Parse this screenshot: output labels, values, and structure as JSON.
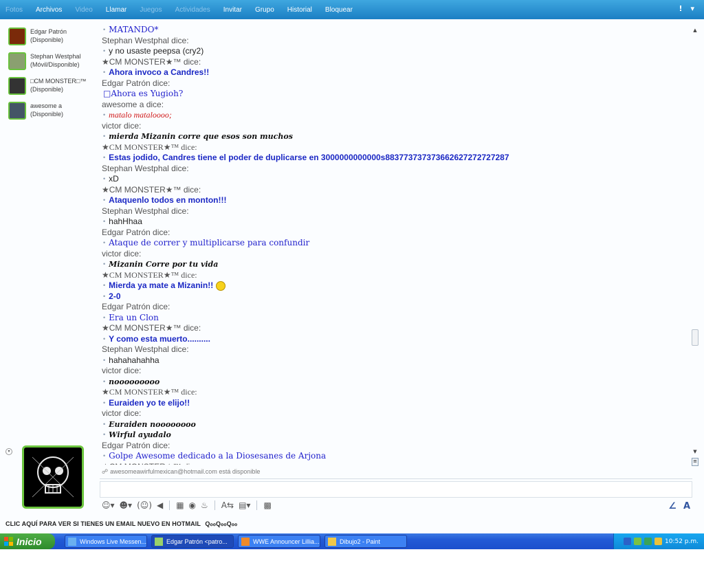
{
  "menu": [
    {
      "label": "Fotos",
      "disabled": true
    },
    {
      "label": "Archivos",
      "disabled": false
    },
    {
      "label": "Video",
      "disabled": true
    },
    {
      "label": "Llamar",
      "disabled": false
    },
    {
      "label": "Juegos",
      "disabled": true
    },
    {
      "label": "Actividades",
      "disabled": true
    },
    {
      "label": "Invitar",
      "disabled": false
    },
    {
      "label": "Grupo",
      "disabled": false
    },
    {
      "label": "Historial",
      "disabled": false
    },
    {
      "label": "Bloquear",
      "disabled": false
    }
  ],
  "topbar_right": {
    "alert": "!",
    "options": "▾"
  },
  "contacts": [
    {
      "name": "Edgar Patrón",
      "status": "(Disponible)",
      "avatar": "fire-avatar"
    },
    {
      "name": "Stephan Westphal",
      "status": "(Móvil/Disponible)",
      "avatar": "person-avatar"
    },
    {
      "name": "□CM MONSTER□™",
      "status": "(Disponible)",
      "avatar": "wrestler-avatar"
    },
    {
      "name": "awesome a",
      "status": "(Disponible)",
      "avatar": "ring-avatar"
    }
  ],
  "conversation": [
    {
      "type": "msg",
      "text": "MATANDO*",
      "style": "c-serif"
    },
    {
      "type": "speaker",
      "text": "Stephan Westphal dice:"
    },
    {
      "type": "msg",
      "text": "y no usaste peepsa (cry2)",
      "style": "c-black"
    },
    {
      "type": "speaker",
      "text": "★CM MONSTER★™ dice:"
    },
    {
      "type": "msg",
      "text": "Ahora invoco a Candres!!",
      "style": "c-bold-blue"
    },
    {
      "type": "speaker",
      "text": "Edgar Patrón dice:"
    },
    {
      "type": "msg",
      "text": "□Ahora es Yugioh?",
      "style": "c-serif",
      "nodot": true
    },
    {
      "type": "speaker",
      "text": "awesome a dice:"
    },
    {
      "type": "msg",
      "text": "matalo mataloooo;",
      "style": "c-red"
    },
    {
      "type": "speaker",
      "text": "victor dice:"
    },
    {
      "type": "msg",
      "text": "mierda Mizanin corre que esos son muchos",
      "style": "c-serif-bold"
    },
    {
      "type": "speaker",
      "text": "★CM MONSTER★™ dice:",
      "serif": true
    },
    {
      "type": "msg",
      "text": "Estas jodido, Candres tiene el poder de duplicarse en 3000000000000s883773737373662627272727287",
      "style": "c-bold-blue"
    },
    {
      "type": "speaker",
      "text": "Stephan Westphal dice:"
    },
    {
      "type": "msg",
      "text": "xD",
      "style": "c-black"
    },
    {
      "type": "speaker",
      "text": "★CM MONSTER★™ dice:"
    },
    {
      "type": "msg",
      "text": "Ataquenlo todos en monton!!!",
      "style": "c-bold-blue"
    },
    {
      "type": "speaker",
      "text": "Stephan Westphal dice:"
    },
    {
      "type": "msg",
      "text": "hahHhaa",
      "style": "c-black"
    },
    {
      "type": "speaker",
      "text": "Edgar Patrón dice:"
    },
    {
      "type": "msg",
      "text": "Ataque de correr y multiplicarse para confundir",
      "style": "c-serif"
    },
    {
      "type": "speaker",
      "text": "victor dice:"
    },
    {
      "type": "msg",
      "text": "Mizanin Corre por tu vida",
      "style": "c-serif-bold"
    },
    {
      "type": "speaker",
      "text": "★CM MONSTER★™ dice:",
      "serif": true
    },
    {
      "type": "msg",
      "text": "Mierda ya mate a Mizanin!!",
      "style": "c-bold-blue",
      "emoticon": true
    },
    {
      "type": "msg",
      "text": "2-0",
      "style": "c-bold-blue"
    },
    {
      "type": "speaker",
      "text": "Edgar Patrón dice:"
    },
    {
      "type": "msg",
      "text": "Era un Clon",
      "style": "c-serif"
    },
    {
      "type": "speaker",
      "text": "★CM MONSTER★™ dice:"
    },
    {
      "type": "msg",
      "text": "Y como esta muerto..........",
      "style": "c-bold-blue"
    },
    {
      "type": "speaker",
      "text": "Stephan Westphal dice:"
    },
    {
      "type": "msg",
      "text": "hahahahahha",
      "style": "c-black"
    },
    {
      "type": "speaker",
      "text": "victor dice:"
    },
    {
      "type": "msg",
      "text": "nooooooooo",
      "style": "c-serif-bold"
    },
    {
      "type": "speaker",
      "text": "★CM MONSTER★™ dice:",
      "serif": true
    },
    {
      "type": "msg",
      "text": "Euraiden yo te elijo!!",
      "style": "c-bold-blue"
    },
    {
      "type": "speaker",
      "text": "victor dice:"
    },
    {
      "type": "msg",
      "text": "Euraiden noooooooo",
      "style": "c-serif-bold"
    },
    {
      "type": "msg",
      "text": "Wirful ayudalo",
      "style": "c-serif-bold"
    },
    {
      "type": "speaker",
      "text": "Edgar Patrón dice:"
    },
    {
      "type": "msg",
      "text": "Golpe Awesome dedicado a la Diosesanes de Arjona",
      "style": "c-serif"
    },
    {
      "type": "speaker",
      "text": "★CM MONSTER★™ dice:"
    }
  ],
  "status_line": "awesomeawirfulmexican@hotmail.com está disponible",
  "hotmail_link": "CLIC AQUÍ PARA VER SI TIENES UN EMAIL NUEVO EN HOTMAIL",
  "hotmail_suffix": "QℴℴQℴℴQℴℴ",
  "taskbar": {
    "start_label": "Inicio",
    "tasks": [
      {
        "label": "Windows Live Messen...",
        "active": false
      },
      {
        "label": "Edgar Patrón <patro...",
        "active": true
      },
      {
        "label": "WWE Announcer Lillia...",
        "active": false
      },
      {
        "label": "Dibujo2 - Paint",
        "active": false
      }
    ],
    "clock": "10:52 p.m."
  },
  "colors": {
    "topbar": "#1b7fc4",
    "green_frame": "#6cc63e",
    "taskbar": "#225ad6",
    "start": "#2e8b2c"
  }
}
